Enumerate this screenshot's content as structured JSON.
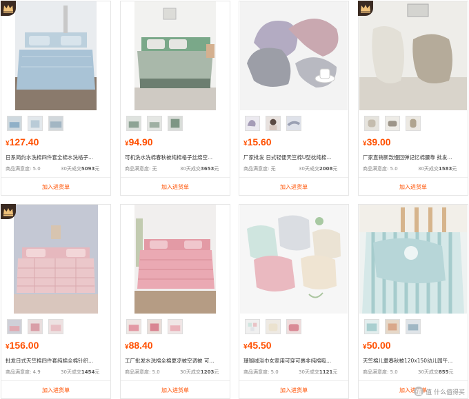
{
  "products": [
    {
      "price": "127.40",
      "title": "日系简约水洗棉四件套全棉水洗格子...",
      "rating_label": "商品满意度: 5.0",
      "sold_label": "30天成交",
      "sold_count": "5093",
      "sold_unit": "元",
      "add_button": "加入进货单",
      "badge": true,
      "accent": "#aec7dc"
    },
    {
      "price": "94.90",
      "title": "可机洗水洗棉春秋被纯棉格子丝绵空...",
      "rating_label": "商品满意度: 无",
      "sold_label": "30天成交",
      "sold_count": "3653",
      "sold_unit": "元",
      "add_button": "加入进货单",
      "badge": false,
      "accent": "#9fb2a0"
    },
    {
      "price": "15.60",
      "title": "厂家批发 日式轻便天竺棉U型枕纯棉...",
      "rating_label": "商品满意度: 无",
      "sold_label": "30天成交",
      "sold_count": "2008",
      "sold_unit": "元",
      "add_button": "加入进货单",
      "badge": false,
      "accent": "#a9a3b8"
    },
    {
      "price": "39.00",
      "title": "厂家直销新款慢回弹记忆棉腰靠 批发...",
      "rating_label": "商品满意度: 5.0",
      "sold_label": "30天成交",
      "sold_count": "1583",
      "sold_unit": "元",
      "add_button": "加入进货单",
      "badge": true,
      "accent": "#c9c2b4"
    },
    {
      "price": "156.00",
      "title": "批发日式天竺棉四件套纯棉全棉针织...",
      "rating_label": "商品满意度: 4.9",
      "sold_label": "30天成交",
      "sold_count": "1454",
      "sold_unit": "元",
      "add_button": "加入进货单",
      "badge": true,
      "accent": "#e6b8be"
    },
    {
      "price": "88.40",
      "title": "工厂批发水洗棉全棉夏凉被空调被 可...",
      "rating_label": "商品满意度: 5.0",
      "sold_label": "30天成交",
      "sold_count": "1203",
      "sold_unit": "元",
      "add_button": "加入进货单",
      "badge": false,
      "accent": "#e9a4ae"
    },
    {
      "price": "45.50",
      "title": "珊瑚绒浴巾女家用可穿可裹非纯棉吸...",
      "rating_label": "商品满意度: 5.0",
      "sold_label": "30天成交",
      "sold_count": "1121",
      "sold_unit": "元",
      "add_button": "加入进货单",
      "badge": false,
      "accent": "#e9c3c6"
    },
    {
      "price": "50.00",
      "title": "天竺棉儿童春秋被120x150幼儿园午...",
      "rating_label": "商品满意度: 5.0",
      "sold_label": "30天成交",
      "sold_count": "855",
      "sold_unit": "元",
      "add_button": "加入进货单",
      "badge": false,
      "accent": "#9fc7c9"
    }
  ],
  "currency_symbol": "¥",
  "watermark": {
    "text": "值 什么值得买",
    "logo": "值"
  }
}
